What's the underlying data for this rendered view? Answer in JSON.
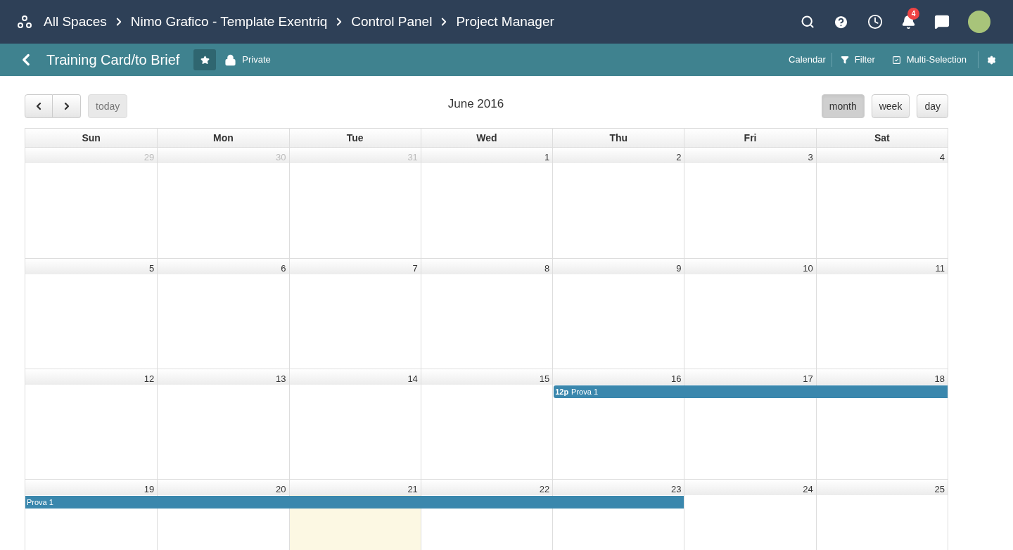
{
  "breadcrumbs": [
    "All Spaces",
    "Nimo Grafico - Template Exentriq",
    "Control Panel",
    "Project Manager"
  ],
  "notifications": {
    "count": "4"
  },
  "subheader": {
    "title": "Training Card/to Brief",
    "starred": true,
    "privacy": "Private",
    "actions": [
      {
        "kind": "text",
        "label": "Calendar"
      },
      {
        "kind": "filter",
        "label": "Filter"
      },
      {
        "kind": "check",
        "label": "Multi-Selection"
      },
      {
        "kind": "settings"
      }
    ]
  },
  "calendar": {
    "title": "June 2016",
    "today_button": "today",
    "views": [
      {
        "label": "month",
        "selected": true
      },
      {
        "label": "week",
        "selected": false
      },
      {
        "label": "day",
        "selected": false
      }
    ],
    "weekdays": [
      "Sun",
      "Mon",
      "Tue",
      "Wed",
      "Thu",
      "Fri",
      "Sat"
    ],
    "weeks": [
      {
        "days": [
          {
            "label": "29",
            "other_month": true,
            "today": false,
            "in_event": false
          },
          {
            "label": "30",
            "other_month": true,
            "today": false,
            "in_event": false
          },
          {
            "label": "31",
            "other_month": true,
            "today": false,
            "in_event": false
          },
          {
            "label": "1",
            "other_month": false,
            "today": false,
            "in_event": false
          },
          {
            "label": "2",
            "other_month": false,
            "today": false,
            "in_event": false
          },
          {
            "label": "3",
            "other_month": false,
            "today": false,
            "in_event": false
          },
          {
            "label": "4",
            "other_month": false,
            "today": false,
            "in_event": false
          }
        ]
      },
      {
        "days": [
          {
            "label": "5",
            "other_month": false,
            "today": false,
            "in_event": false
          },
          {
            "label": "6",
            "other_month": false,
            "today": false,
            "in_event": false
          },
          {
            "label": "7",
            "other_month": false,
            "today": false,
            "in_event": false
          },
          {
            "label": "8",
            "other_month": false,
            "today": false,
            "in_event": false
          },
          {
            "label": "9",
            "other_month": false,
            "today": false,
            "in_event": false
          },
          {
            "label": "10",
            "other_month": false,
            "today": false,
            "in_event": false
          },
          {
            "label": "11",
            "other_month": false,
            "today": false,
            "in_event": false
          }
        ]
      },
      {
        "event": {
          "time": "12p",
          "title": "Prova 1"
        },
        "days": [
          {
            "label": "12",
            "other_month": false,
            "today": false,
            "in_event": false
          },
          {
            "label": "13",
            "other_month": false,
            "today": false,
            "in_event": false
          },
          {
            "label": "14",
            "other_month": false,
            "today": false,
            "in_event": false
          },
          {
            "label": "15",
            "other_month": false,
            "today": false,
            "in_event": false
          },
          {
            "label": "16",
            "other_month": false,
            "today": false,
            "in_event": true
          },
          {
            "label": "17",
            "other_month": false,
            "today": false,
            "in_event": true
          },
          {
            "label": "18",
            "other_month": false,
            "today": false,
            "in_event": true
          }
        ]
      },
      {
        "event": {
          "title": "Prova 1"
        },
        "days": [
          {
            "label": "19",
            "other_month": false,
            "today": false,
            "in_event": true
          },
          {
            "label": "20",
            "other_month": false,
            "today": false,
            "in_event": true
          },
          {
            "label": "21",
            "other_month": false,
            "today": true,
            "in_event": true
          },
          {
            "label": "22",
            "other_month": false,
            "today": false,
            "in_event": true
          },
          {
            "label": "23",
            "other_month": false,
            "today": false,
            "in_event": true
          },
          {
            "label": "24",
            "other_month": false,
            "today": false,
            "in_event": false
          },
          {
            "label": "25",
            "other_month": false,
            "today": false,
            "in_event": false
          }
        ]
      }
    ]
  }
}
